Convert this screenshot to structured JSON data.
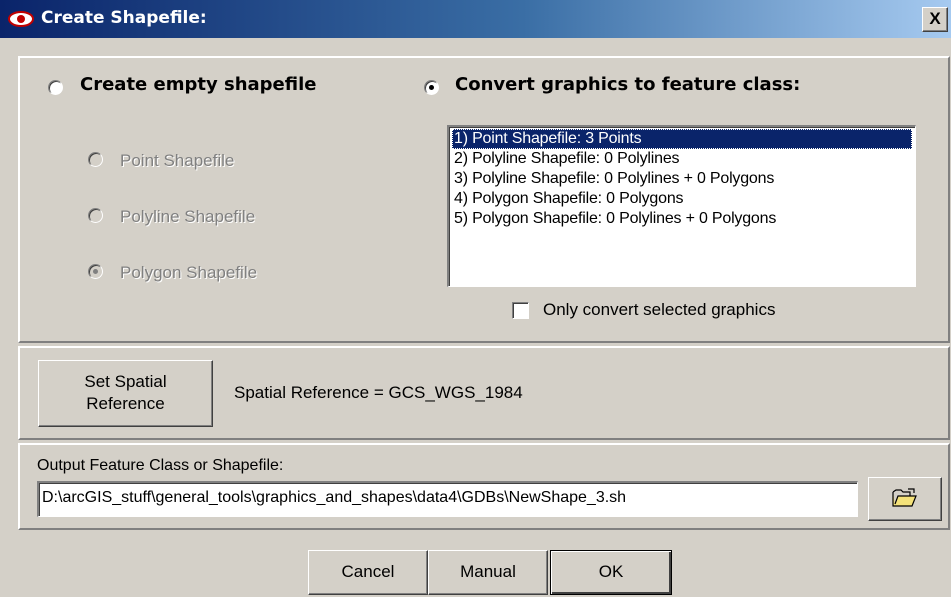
{
  "window": {
    "title": "Create Shapefile:",
    "close_glyph": "X",
    "icon": "eye-icon"
  },
  "mode": {
    "empty_label": "Create empty shapefile",
    "convert_label": "Convert graphics to feature class:",
    "selected": "convert"
  },
  "shape_types": {
    "items": [
      {
        "label": "Point Shapefile",
        "checked": false
      },
      {
        "label": "Polyline Shapefile",
        "checked": false
      },
      {
        "label": "Polygon Shapefile",
        "checked": true
      }
    ],
    "enabled": false
  },
  "graphics_list": {
    "items": [
      "1) Point Shapefile: 3 Points",
      "2) Polyline Shapefile: 0 Polylines",
      "3) Polyline Shapefile: 0 Polylines + 0 Polygons",
      "4) Polygon Shapefile: 0 Polygons",
      "5) Polygon Shapefile: 0 Polylines + 0 Polygons"
    ],
    "selected_index": 0
  },
  "only_selected": {
    "label": "Only convert selected graphics",
    "checked": false
  },
  "spatial": {
    "button_label_line1": "Set Spatial",
    "button_label_line2": "Reference",
    "reference_text": "Spatial Reference = GCS_WGS_1984"
  },
  "output": {
    "label": "Output Feature Class or Shapefile:",
    "path": "D:\\arcGIS_stuff\\general_tools\\graphics_and_shapes\\data4\\GDBs\\NewShape_3.sh",
    "browse_icon": "open-folder-icon"
  },
  "buttons": {
    "cancel": "Cancel",
    "manual": "Manual",
    "ok": "OK"
  },
  "colors": {
    "title_start": "#0a246a",
    "title_end": "#a6caf0",
    "face": "#d4d0c8",
    "selection": "#0a246a"
  }
}
